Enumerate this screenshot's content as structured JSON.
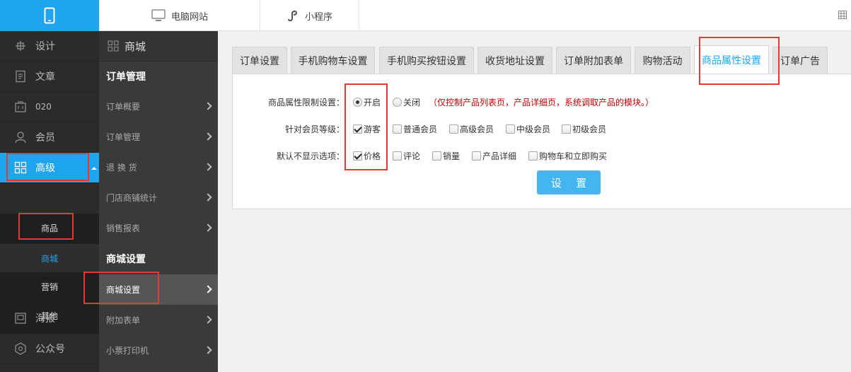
{
  "colors": {
    "accent": "#1ea5ee",
    "highlight": "#e53935",
    "note": "#c00000"
  },
  "topbar": {
    "mobile_icon": "mobile-phone-icon",
    "tabs": [
      {
        "label": "电脑网站",
        "icon": "monitor-icon"
      },
      {
        "label": "小程序",
        "icon": "mini-program-icon"
      }
    ]
  },
  "sidebar": {
    "items": [
      {
        "label": "设计",
        "icon": "design-icon"
      },
      {
        "label": "文章",
        "icon": "article-icon"
      },
      {
        "label": "020",
        "icon": "o2o-icon"
      },
      {
        "label": "会员",
        "icon": "member-icon"
      },
      {
        "label": "高级",
        "icon": "grid-icon"
      },
      {
        "label": "海报",
        "icon": "poster-icon"
      },
      {
        "label": "公众号",
        "icon": "official-account-icon"
      }
    ],
    "sub_items": [
      "商品",
      "商城",
      "营销",
      "其他"
    ]
  },
  "sidebar2": {
    "title": "商城",
    "sections": [
      {
        "title": "订单管理",
        "links": [
          "订单概要",
          "订单管理",
          "退 换 货",
          "门店商铺统计",
          "销售报表"
        ]
      },
      {
        "title": "商城设置",
        "links": [
          "商城设置",
          "附加表单",
          "小票打印机"
        ]
      }
    ]
  },
  "tabs": [
    "订单设置",
    "手机购物车设置",
    "手机购买按钮设置",
    "收货地址设置",
    "订单附加表单",
    "购物活动",
    "商品属性设置",
    "订单广告"
  ],
  "form": {
    "row1": {
      "label": "商品属性限制设置：",
      "options": [
        {
          "label": "开启",
          "checked": true
        },
        {
          "label": "关闭",
          "checked": false
        }
      ],
      "note": "（仅控制产品列表页，产品详细页，系统调取产品的模块。）"
    },
    "row2": {
      "label": "针对会员等级：",
      "options": [
        {
          "label": "游客",
          "checked": true
        },
        {
          "label": "普通会员",
          "checked": false
        },
        {
          "label": "高级会员",
          "checked": false
        },
        {
          "label": "中级会员",
          "checked": false
        },
        {
          "label": "初级会员",
          "checked": false
        }
      ]
    },
    "row3": {
      "label": "默认不显示选项：",
      "options": [
        {
          "label": "价格",
          "checked": true
        },
        {
          "label": "评论",
          "checked": false
        },
        {
          "label": "销量",
          "checked": false
        },
        {
          "label": "产品详细",
          "checked": false
        },
        {
          "label": "购物车和立即购买",
          "checked": false
        }
      ]
    },
    "submit_label": "设 置"
  }
}
